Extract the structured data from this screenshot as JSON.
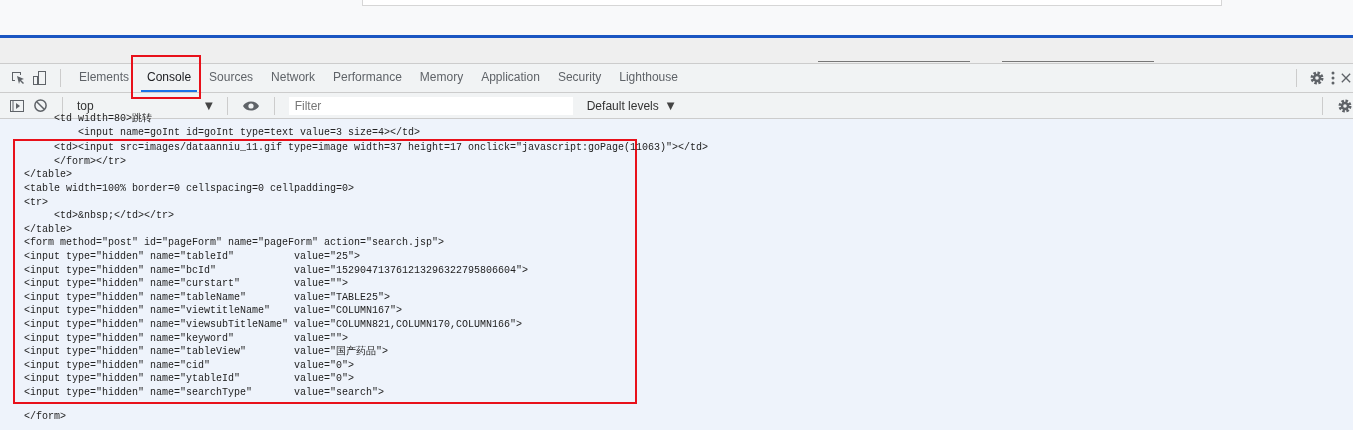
{
  "devtools": {
    "tabs": [
      {
        "label": "Elements",
        "selected": false,
        "highlighted": false
      },
      {
        "label": "Console",
        "selected": true,
        "highlighted": true
      },
      {
        "label": "Sources",
        "selected": false,
        "highlighted": false
      },
      {
        "label": "Network",
        "selected": false,
        "highlighted": false
      },
      {
        "label": "Performance",
        "selected": false,
        "highlighted": false
      },
      {
        "label": "Memory",
        "selected": false,
        "highlighted": false
      },
      {
        "label": "Application",
        "selected": false,
        "highlighted": false
      },
      {
        "label": "Security",
        "selected": false,
        "highlighted": false
      },
      {
        "label": "Lighthouse",
        "selected": false,
        "highlighted": false
      }
    ],
    "console_toolbar": {
      "context": "top",
      "context_caret": "▼",
      "filter": {
        "placeholder": "Filter"
      },
      "levels": "Default levels",
      "levels_caret": "▼"
    },
    "console_lines_before": [
      "     <td width=80>跳转",
      "         <input name=goInt id=goInt type=text value=3 size=4></td>"
    ],
    "highlight_box": {
      "lines": [
        "     <td><input src=images/dataanniu_11.gif type=image width=37 height=17 onclick=\"javascript:goPage(11063)\"></td>",
        "     </form></tr>",
        "</table>",
        "<table width=100% border=0 cellspacing=0 cellpadding=0>",
        "<tr>",
        "     <td>&nbsp;</td></tr>",
        "</table>",
        "<form method=\"post\" id=\"pageForm\" name=\"pageForm\" action=\"search.jsp\">",
        "<input type=\"hidden\" name=\"tableId\"          value=\"25\">",
        "<input type=\"hidden\" name=\"bcId\"             value=\"152904713761213296322795806604\">",
        "<input type=\"hidden\" name=\"curstart\"         value=\"\">",
        "<input type=\"hidden\" name=\"tableName\"        value=\"TABLE25\">",
        "<input type=\"hidden\" name=\"viewtitleName\"    value=\"COLUMN167\">",
        "<input type=\"hidden\" name=\"viewsubTitleName\" value=\"COLUMN821,COLUMN170,COLUMN166\">",
        "<input type=\"hidden\" name=\"keyword\"          value=\"\">",
        "<input type=\"hidden\" name=\"tableView\"        value=\"国产药品\">",
        "<input type=\"hidden\" name=\"cid\"              value=\"0\">",
        "<input type=\"hidden\" name=\"ytableId\"         value=\"0\">",
        "<input type=\"hidden\" name=\"searchType\"       value=\"search\">"
      ]
    },
    "console_lines_after": [
      "</form>"
    ]
  }
}
